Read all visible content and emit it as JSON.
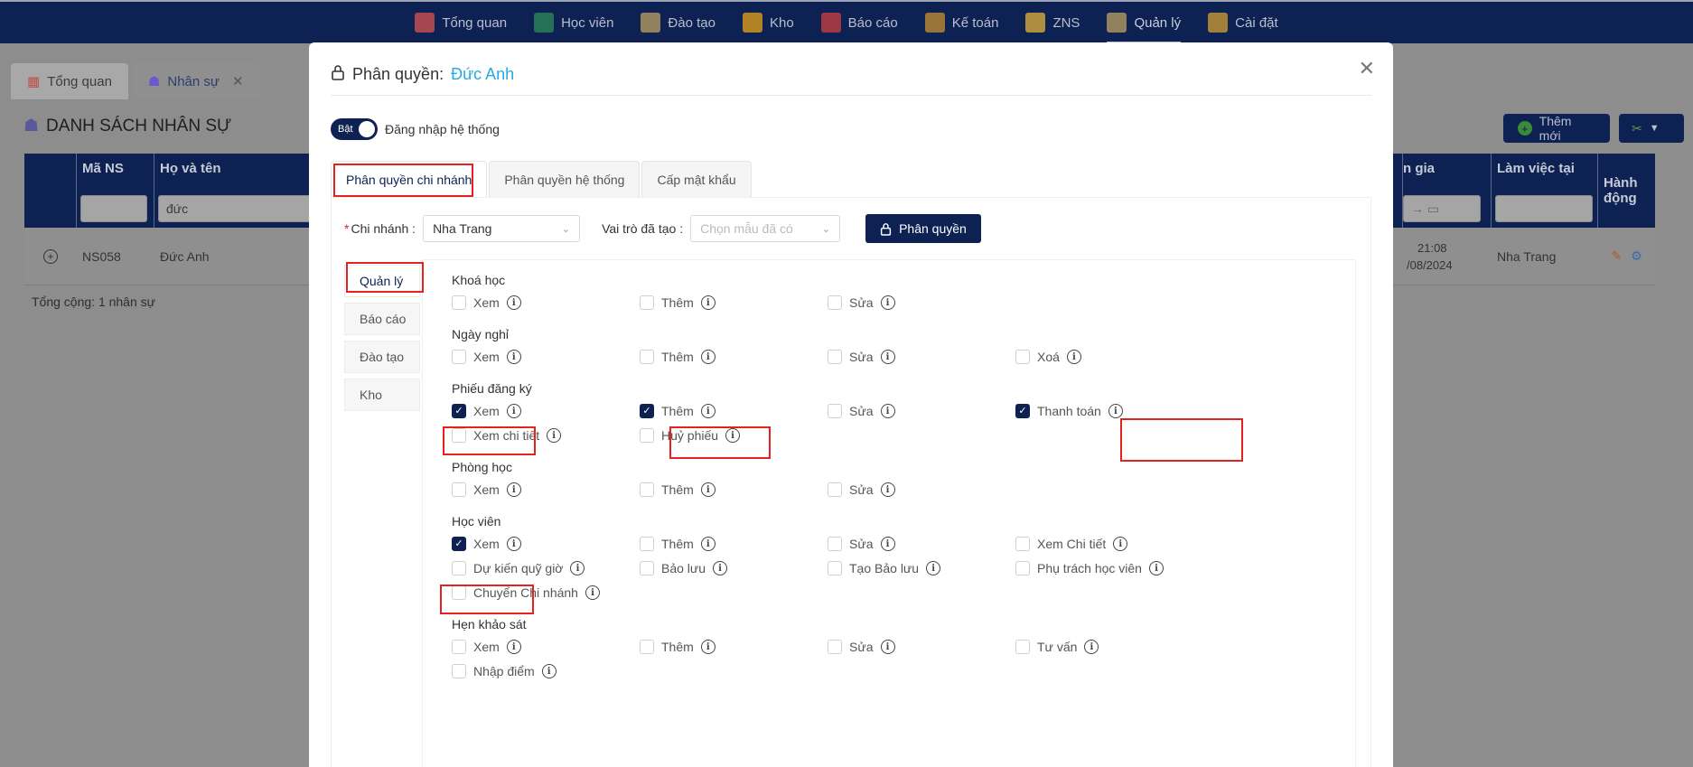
{
  "topnav": {
    "items": [
      {
        "label": "Tổng quan",
        "icon": "dashboard-icon",
        "color": "#d9534f"
      },
      {
        "label": "Học viên",
        "icon": "student-cap-icon",
        "color": "#2e8b57"
      },
      {
        "label": "Đào tạo",
        "icon": "training-board-icon",
        "color": "#c0a060"
      },
      {
        "label": "Kho",
        "icon": "box-icon",
        "color": "#e8a317"
      },
      {
        "label": "Báo cáo",
        "icon": "bar-chart-icon",
        "color": "#d04040"
      },
      {
        "label": "Kế toán",
        "icon": "accounting-icon",
        "color": "#c89030"
      },
      {
        "label": "ZNS",
        "icon": "zns-icon",
        "color": "#e3b33a"
      },
      {
        "label": "Quản lý",
        "icon": "manage-gear-icon",
        "color": "#c0a060"
      },
      {
        "label": "Cài đặt",
        "icon": "settings-gear-icon",
        "color": "#d4a030"
      }
    ],
    "active": "Quản lý"
  },
  "background": {
    "tabs": [
      "Tổng quan",
      "Nhân sự"
    ],
    "page_title": "DANH SÁCH NHÂN SỰ",
    "add_button": "Thêm mới",
    "columns": {
      "code": "Mã NS",
      "name": "Họ và tên",
      "join": "n gia",
      "workplace": "Làm việc tại",
      "actions": "Hành động"
    },
    "filter_name": "đức",
    "row": {
      "code": "NS058",
      "name": "Đức Anh",
      "time": "21:08",
      "date": "/08/2024",
      "workplace": "Nha Trang"
    },
    "total": "Tổng cộng: 1 nhân sự"
  },
  "modal": {
    "title": "Phân quyền:",
    "person": "Đức Anh",
    "toggle_on_label": "Bật",
    "toggle_label": "Đăng nhập hệ thống",
    "tabs": [
      "Phân quyền chi nhánh",
      "Phân quyền hệ thống",
      "Cấp mật khẩu"
    ],
    "branch_label": "Chi nhánh :",
    "branch_value": "Nha Trang",
    "role_label": "Vai trò đã tạo :",
    "role_placeholder": "Chọn mẫu đã có",
    "perm_button": "Phân quyền",
    "side_tabs": [
      "Quản lý",
      "Báo cáo",
      "Đào tạo",
      "Kho"
    ]
  },
  "permissions": [
    {
      "group": "Khoá học",
      "items": [
        {
          "label": "Xem",
          "checked": false
        },
        {
          "label": "Thêm",
          "checked": false
        },
        {
          "label": "Sửa",
          "checked": false
        }
      ]
    },
    {
      "group": "Ngày nghỉ",
      "items": [
        {
          "label": "Xem",
          "checked": false
        },
        {
          "label": "Thêm",
          "checked": false
        },
        {
          "label": "Sửa",
          "checked": false
        },
        {
          "label": "Xoá",
          "checked": false
        }
      ]
    },
    {
      "group": "Phiếu đăng ký",
      "items": [
        {
          "label": "Xem",
          "checked": true
        },
        {
          "label": "Thêm",
          "checked": true
        },
        {
          "label": "Sửa",
          "checked": false
        },
        {
          "label": "Thanh toán",
          "checked": true
        },
        {
          "label": "Xem chi tiết",
          "checked": false
        },
        {
          "label": "Huỷ phiếu",
          "checked": false
        }
      ]
    },
    {
      "group": "Phòng học",
      "items": [
        {
          "label": "Xem",
          "checked": false
        },
        {
          "label": "Thêm",
          "checked": false
        },
        {
          "label": "Sửa",
          "checked": false
        }
      ]
    },
    {
      "group": "Học viên",
      "items": [
        {
          "label": "Xem",
          "checked": true
        },
        {
          "label": "Thêm",
          "checked": false
        },
        {
          "label": "Sửa",
          "checked": false
        },
        {
          "label": "Xem Chi tiết",
          "checked": false
        },
        {
          "label": "Dự kiến quỹ giờ",
          "checked": false
        },
        {
          "label": "Bảo lưu",
          "checked": false
        },
        {
          "label": "Tạo Bảo lưu",
          "checked": false
        },
        {
          "label": "Phụ trách học viên",
          "checked": false
        },
        {
          "label": "Chuyển Chi nhánh",
          "checked": false
        }
      ]
    },
    {
      "group": "Hẹn khảo sát",
      "items": [
        {
          "label": "Xem",
          "checked": false
        },
        {
          "label": "Thêm",
          "checked": false
        },
        {
          "label": "Sửa",
          "checked": false
        },
        {
          "label": "Tư vấn",
          "checked": false
        },
        {
          "label": "Nhập điểm",
          "checked": false
        }
      ]
    }
  ],
  "colors": {
    "navy": "#0d2153",
    "accent_name": "#27a9e1",
    "highlight": "#e32222"
  }
}
